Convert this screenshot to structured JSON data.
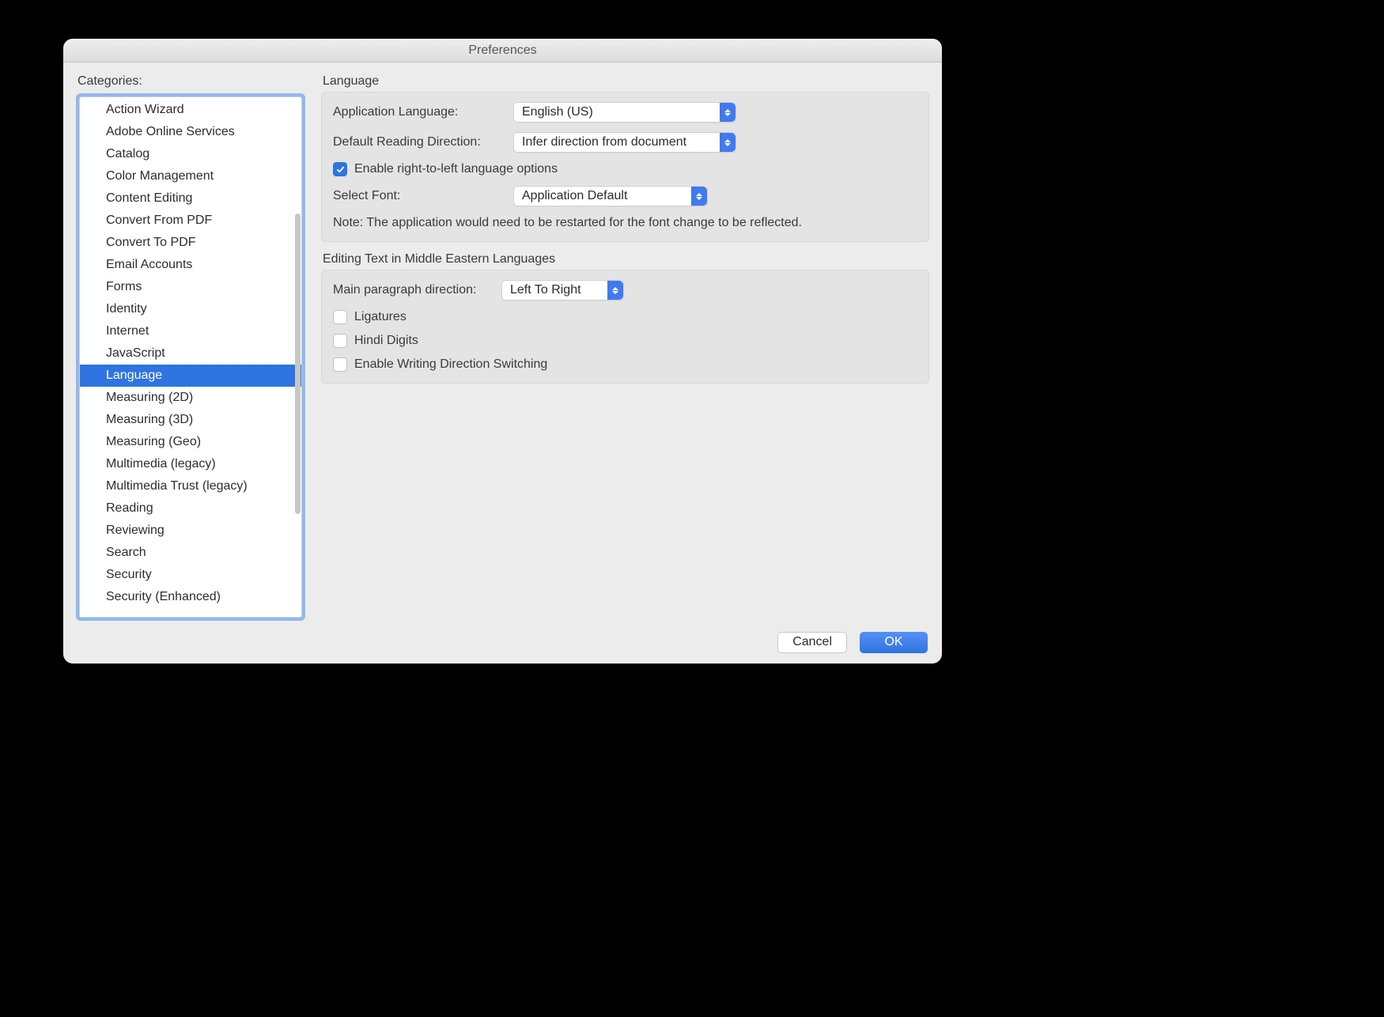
{
  "window": {
    "title": "Preferences"
  },
  "sidebar": {
    "label": "Categories:",
    "selected_index": 12,
    "items": [
      "Action Wizard",
      "Adobe Online Services",
      "Catalog",
      "Color Management",
      "Content Editing",
      "Convert From PDF",
      "Convert To PDF",
      "Email Accounts",
      "Forms",
      "Identity",
      "Internet",
      "JavaScript",
      "Language",
      "Measuring (2D)",
      "Measuring (3D)",
      "Measuring (Geo)",
      "Multimedia (legacy)",
      "Multimedia Trust (legacy)",
      "Reading",
      "Reviewing",
      "Search",
      "Security",
      "Security (Enhanced)"
    ]
  },
  "panel1": {
    "title": "Language",
    "app_lang_label": "Application Language:",
    "app_lang_value": "English (US)",
    "reading_dir_label": "Default Reading Direction:",
    "reading_dir_value": "Infer direction from document",
    "rtl_checkbox_label": "Enable right-to-left language options",
    "rtl_checked": true,
    "select_font_label": "Select Font:",
    "select_font_value": "Application Default",
    "note": "Note: The application would need to be restarted for the font change to be reflected."
  },
  "panel2": {
    "title": "Editing Text in Middle Eastern Languages",
    "para_dir_label": "Main paragraph direction:",
    "para_dir_value": "Left To Right",
    "ligatures_label": "Ligatures",
    "ligatures_checked": false,
    "hindi_digits_label": "Hindi Digits",
    "hindi_digits_checked": false,
    "writing_switch_label": "Enable Writing Direction Switching",
    "writing_switch_checked": false
  },
  "footer": {
    "cancel": "Cancel",
    "ok": "OK"
  }
}
